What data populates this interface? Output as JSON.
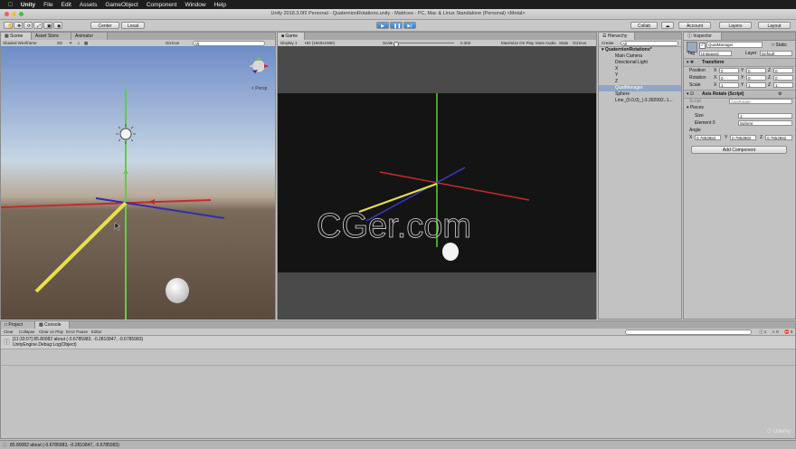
{
  "menubar": {
    "apple_icon": "apple-icon",
    "items": [
      "Unity",
      "File",
      "Edit",
      "Assets",
      "GameObject",
      "Component",
      "Window",
      "Help"
    ]
  },
  "window": {
    "title": "Unity 2018.3.0f2 Personal - QuaternionRotations.unity - Matrices - PC, Mac & Linux Standalone (Personal) <Metal>"
  },
  "toolbar": {
    "pivot": "Center",
    "space": "Local",
    "collab": "Collab",
    "account": "Account",
    "layers": "Layers",
    "layout": "Layout"
  },
  "scene": {
    "tab_scene": "Scene",
    "tab_asset_store": "Asset Store",
    "tab_animator": "Animator",
    "shading": "Shaded Wireframe",
    "mode_2d": "2D",
    "gizmos": "Gizmos",
    "search_placeholder": "All",
    "persp": "< Persp"
  },
  "game": {
    "tab": "Game",
    "display": "Display 1",
    "resolution": "HD (1920x1080)",
    "scale_label": "Scale",
    "scale_value": "0.302",
    "maximize": "Maximize On Play",
    "mute": "Mute Audio",
    "stats": "Stats",
    "gizmos": "Gizmos",
    "watermark": "CGer.com"
  },
  "hierarchy": {
    "tab": "Hierarchy",
    "create": "Create",
    "search_placeholder": "All",
    "scene_name": "QuaternionRotations*",
    "items": [
      "Main Camera",
      "Directional Light",
      "X",
      "Y",
      "Z",
      "QuatManager",
      "Sphere",
      "Line_(0.0,0)_(-3.392992,-1..."
    ],
    "selected_index": 5
  },
  "inspector": {
    "tab": "Inspector",
    "object_name": "QuatManager",
    "static": "Static",
    "tag_label": "Tag",
    "tag_value": "Untagged",
    "layer_label": "Layer",
    "layer_value": "Default",
    "transform": {
      "title": "Transform",
      "position_label": "Position",
      "rotation_label": "Rotation",
      "scale_label": "Scale",
      "position": [
        "0",
        "0",
        "0"
      ],
      "rotation": [
        "0",
        "0",
        "0"
      ],
      "scale": [
        "1",
        "1",
        "1"
      ]
    },
    "script": {
      "title": "Axis Rotate (Script)",
      "script_label": "Script",
      "script_value": "AxisRotate",
      "pieces_label": "Pieces",
      "size_label": "Size",
      "size_value": "1",
      "element_label": "Element 0",
      "element_value": "Sphere",
      "angle_label": "Angle",
      "angle": [
        "0.7853982",
        "0.7853982",
        "0.7853982"
      ]
    },
    "add_component": "Add Component"
  },
  "bottom": {
    "tab_project": "Project",
    "tab_console": "Console",
    "buttons": [
      "Clear",
      "Collapse",
      "Clear on Play",
      "Error Pause",
      "Editor"
    ],
    "counts": [
      "1",
      "0",
      "0"
    ],
    "log_line1": "[11:33:07] 85.80082 about (-0.6785983, -0.2810847, -0.6785983)",
    "log_line2": "UnityEngine.Debug:Log(Object)",
    "status": "85.80082 about (-0.6785983, -0.2810847, -0.6785983)",
    "brand": "Udemy"
  },
  "colors": {
    "x_axis": "#d8333a",
    "y_axis": "#4fcf3a",
    "z_axis": "#3a3ad0",
    "line": "#e8e04a",
    "selection": "#8fa6c8"
  }
}
